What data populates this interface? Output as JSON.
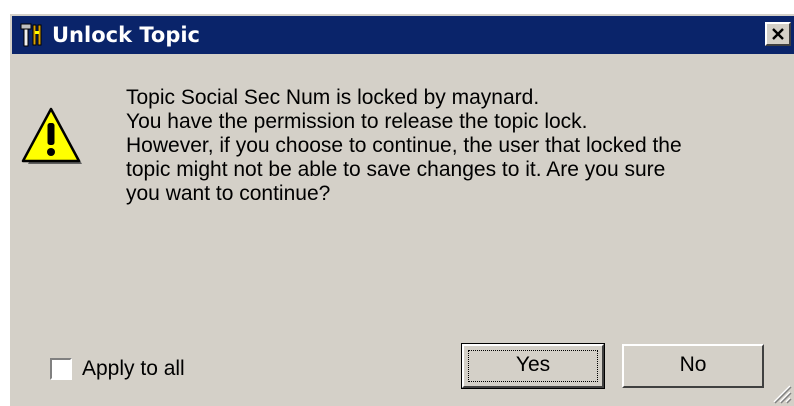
{
  "window": {
    "title": "Unlock Topic",
    "close_glyph": "✕",
    "icons": {
      "app": "tools-icon",
      "warning": "warning-icon",
      "close": "close-icon",
      "grip": "resize-grip-icon"
    }
  },
  "message": {
    "lines": [
      "Topic Social Sec Num is locked by maynard.",
      "You have the permission to release the topic lock.",
      "However, if you choose to continue, the user that locked the",
      "topic might not be able to save changes to it.  Are you sure",
      "you want to continue?"
    ]
  },
  "checkbox": {
    "label": "Apply to all",
    "checked": false
  },
  "buttons": {
    "yes_label": "Yes",
    "no_label": "No",
    "default": "Yes"
  },
  "colors": {
    "titlebar": "#0a246a",
    "face": "#d4d0c8",
    "warning_fill": "#ffff00"
  }
}
